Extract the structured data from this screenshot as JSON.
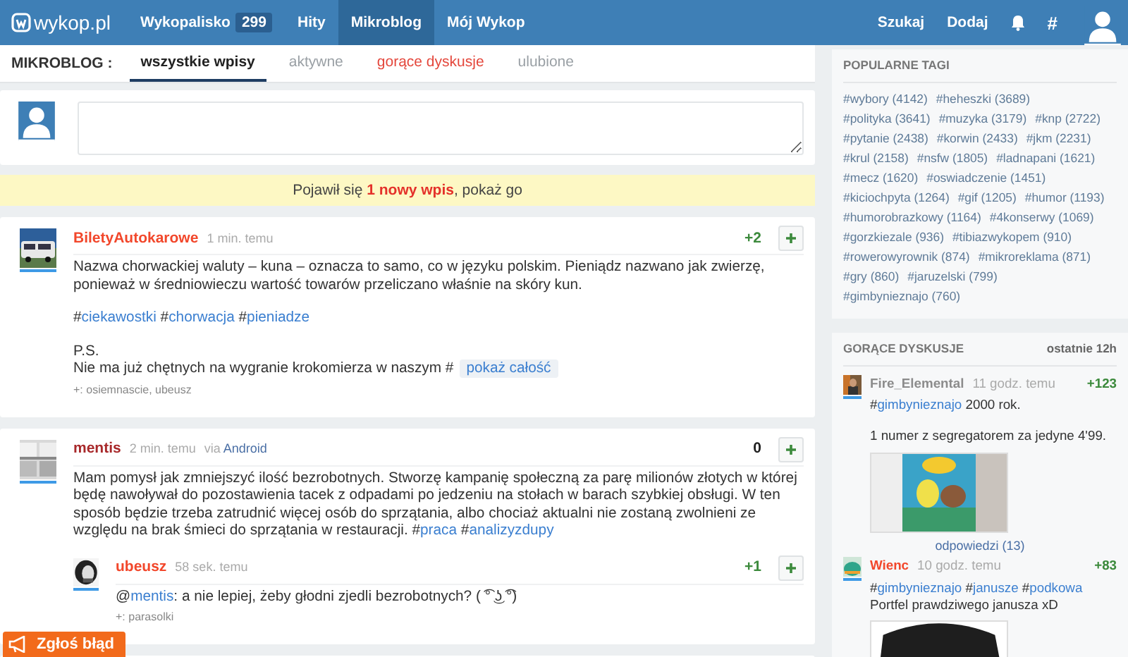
{
  "topbar": {
    "logo": "wykop.pl",
    "nav": [
      {
        "label": "Wykopalisko",
        "count": "299",
        "selected": false
      },
      {
        "label": "Hity",
        "selected": false
      },
      {
        "label": "Mikroblog",
        "selected": true
      },
      {
        "label": "Mój Wykop",
        "selected": false
      }
    ],
    "actions": [
      "Szukaj",
      "Dodaj"
    ],
    "tags_button": "#"
  },
  "subnav": {
    "title": "MIKROBLOG :",
    "tabs": [
      {
        "label": "wszystkie wpisy",
        "selected": true,
        "kind": "normal"
      },
      {
        "label": "aktywne",
        "selected": false,
        "kind": "normal"
      },
      {
        "label": "gorące dyskusje",
        "selected": false,
        "kind": "hot"
      },
      {
        "label": "ulubione",
        "selected": false,
        "kind": "normal"
      }
    ]
  },
  "notice": "Pojawił się **1 nowy wpis**, pokaż go",
  "posts": [
    {
      "author": "BiletyAutokarowe",
      "color": "#f2472b",
      "time": "1 min. temu",
      "vote": {
        "text": "+2",
        "color": "#3c8a3c"
      },
      "blocks": [
        [
          [
            {
              "text": "Nazwa chorwackiej waluty – kuna – oznacza to samo, co w języku polskim. Pieniądz nazwano jak zwierzę, ponieważ w średniowieczu wartość towarów przeliczano właśnie na skóry kun."
            }
          ]
        ],
        [
          [
            {
              "text": "#"
            },
            {
              "tag": "ciekawostki"
            },
            {
              "text": " #"
            },
            {
              "tag": "chorwacja"
            },
            {
              "text": " #"
            },
            {
              "tag": "pieniadze"
            }
          ]
        ],
        [
          [
            {
              "text": "P.S."
            }
          ],
          [
            {
              "text": "Nie ma już chętnych na wygranie krokomierza w naszym #"
            }
          ]
        ]
      ],
      "more": "pokaż całość",
      "voters": "+: osiemnascie, ubeusz"
    },
    {
      "author": "mentis",
      "color": "#a8292b",
      "time": "2 min. temu",
      "via_label": "via",
      "via": "Android",
      "vote": {
        "text": "0",
        "color": "#222222"
      },
      "blocks": [
        [
          [
            {
              "text": "Mam pomysł jak zmniejszyć ilość bezrobotnych. Stworzę kampanię społeczną za parę milionów złotych w której będę nawoływał do pozostawienia tacek z odpadami po jedzeniu na stołach w barach szybkiej obsługi. W ten sposób będzie trzeba zatrudnić więcej osób do sprzątania, albo chociaż aktualni nie zostaną zwolnieni ze względu na brak śmieci do sprzątania w restauracji. #"
            },
            {
              "tag": "praca"
            },
            {
              "text": " #"
            },
            {
              "tag": "analizyzdupy"
            }
          ]
        ]
      ],
      "replies": [
        {
          "author": "ubeusz",
          "color": "#f2472b",
          "time": "58 sek. temu",
          "vote": {
            "text": "+1",
            "color": "#3c8a3c"
          },
          "blocks": [
            [
              [
                {
                  "text": "@"
                },
                {
                  "tag": "mentis"
                },
                {
                  "text": ": a nie lepiej, żeby głodni zjedli bezrobotnych? ( ͡° ͜ʖ ͡°)"
                }
              ]
            ]
          ],
          "voters": "+: parasolki"
        }
      ]
    }
  ],
  "sidebar": {
    "tags_title": "POPULARNE TAGI",
    "tags": [
      "#wybory (4142)",
      "#heheszki (3689)",
      "#polityka (3641)",
      "#muzyka (3179)",
      "#knp (2722)",
      "#pytanie (2438)",
      "#korwin (2433)",
      "#jkm (2231)",
      "#krul (2158)",
      "#nsfw (1805)",
      "#ladnapani (1621)",
      "#mecz (1620)",
      "#oswiadczenie (1451)",
      "#kiciochpyta (1264)",
      "#gif (1205)",
      "#humor (1193)",
      "#humorobrazkowy (1164)",
      "#4konserwy (1069)",
      "#gorzkiezale (936)",
      "#tibiazwykopem (910)",
      "#rowerowyrownik (874)",
      "#mikroreklama (871)",
      "#gry (860)",
      "#jaruzelski (799)",
      "#gimbynieznajo (760)"
    ],
    "hot_title": "GORĄCE DYSKUSJE",
    "hot_period": "ostatnie 12h",
    "hot": [
      {
        "author": "Fire_Elemental",
        "color": "#8c8c8c",
        "time": "11 godz. temu",
        "vote": "+123",
        "blocks": [
          [
            [
              {
                "text": "#"
              },
              {
                "tag": "gimbynieznajo"
              },
              {
                "text": " 2000 rok."
              }
            ]
          ],
          [
            [
              {
                "text": "1 numer z segregatorem za jedyne 4'99."
              }
            ]
          ]
        ],
        "replies_link": "odpowiedzi (13)"
      },
      {
        "author": "Wienc",
        "color": "#f2472b",
        "time": "10 godz. temu",
        "vote": "+83",
        "blocks": [
          [
            [
              {
                "text": "#"
              },
              {
                "tag": "gimbynieznajo"
              },
              {
                "text": " #"
              },
              {
                "tag": "janusze"
              },
              {
                "text": " #"
              },
              {
                "tag": "podkowa"
              }
            ],
            [
              {
                "text": "Portfel prawdziwego janusza xD"
              }
            ]
          ]
        ]
      }
    ]
  },
  "report_button": "Zgłoś błąd"
}
